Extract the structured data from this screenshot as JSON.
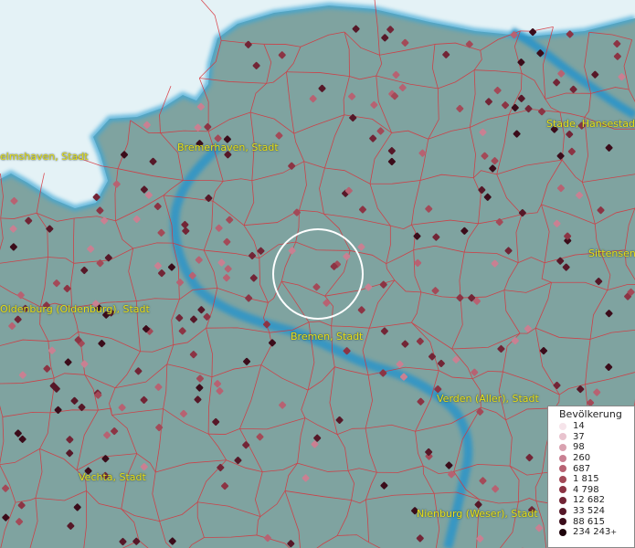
{
  "map": {
    "colors": {
      "land": "#7fa3a0",
      "sea": "#e4f2f6",
      "river": "#2b94c9",
      "borders": "#d8323a",
      "selection": "#ffffff"
    },
    "cities": [
      {
        "name": "Bremerhaven, Stadt"
      },
      {
        "name": "elmshaven, Stadt"
      },
      {
        "name": "Stade, Hansestadt"
      },
      {
        "name": "Sittensen"
      },
      {
        "name": "Oldenburg (Oldenburg), Stadt"
      },
      {
        "name": "Bremen, Stadt"
      },
      {
        "name": "Verden (Aller), Stadt"
      },
      {
        "name": "Vechta, Stadt"
      },
      {
        "name": "Nienburg (Weser), Stadt"
      }
    ]
  },
  "legend": {
    "title": "Bevölkerung",
    "items": [
      {
        "label": "14",
        "color": "#f6e4ea"
      },
      {
        "label": "37",
        "color": "#e8c3ce"
      },
      {
        "label": "98",
        "color": "#d9a2b0"
      },
      {
        "label": "260",
        "color": "#c98092"
      },
      {
        "label": "687",
        "color": "#b76272"
      },
      {
        "label": "1 815",
        "color": "#a34a58"
      },
      {
        "label": "4 798",
        "color": "#8c3444"
      },
      {
        "label": "12 682",
        "color": "#722536"
      },
      {
        "label": "33 524",
        "color": "#561828"
      },
      {
        "label": "88 615",
        "color": "#3b0c1a"
      },
      {
        "label": "234 243",
        "color": "#1f040c"
      }
    ],
    "overflow_marker": "+"
  }
}
